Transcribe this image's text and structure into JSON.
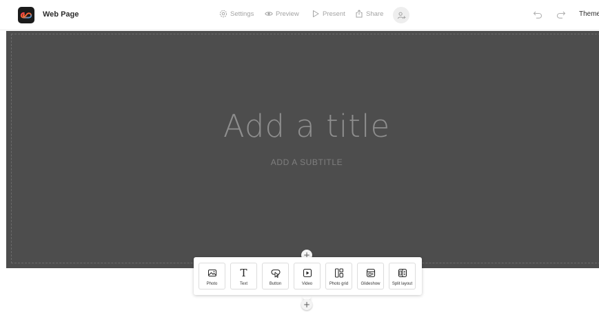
{
  "app": {
    "title": "Web Page"
  },
  "toolbar": {
    "settings": "Settings",
    "preview": "Preview",
    "present": "Present",
    "share": "Share",
    "themes": "Themes"
  },
  "hero": {
    "title": "Add a title",
    "subtitle": "ADD A SUBTITLE"
  },
  "add_block": {
    "symbol": "+"
  },
  "blocks": [
    {
      "label": "Photo",
      "icon": "image-icon"
    },
    {
      "label": "Text",
      "icon": "text-icon"
    },
    {
      "label": "Button",
      "icon": "button-icon"
    },
    {
      "label": "Video",
      "icon": "video-icon"
    },
    {
      "label": "Photo grid",
      "icon": "photo-grid-icon"
    },
    {
      "label": "Glideshow",
      "icon": "glideshow-icon"
    },
    {
      "label": "Split layout",
      "icon": "split-layout-icon"
    }
  ],
  "colors": {
    "hero_background": "#4d4d4d",
    "toolbar_text": "#a3a3a3",
    "title_text": "#2c2c2c"
  }
}
